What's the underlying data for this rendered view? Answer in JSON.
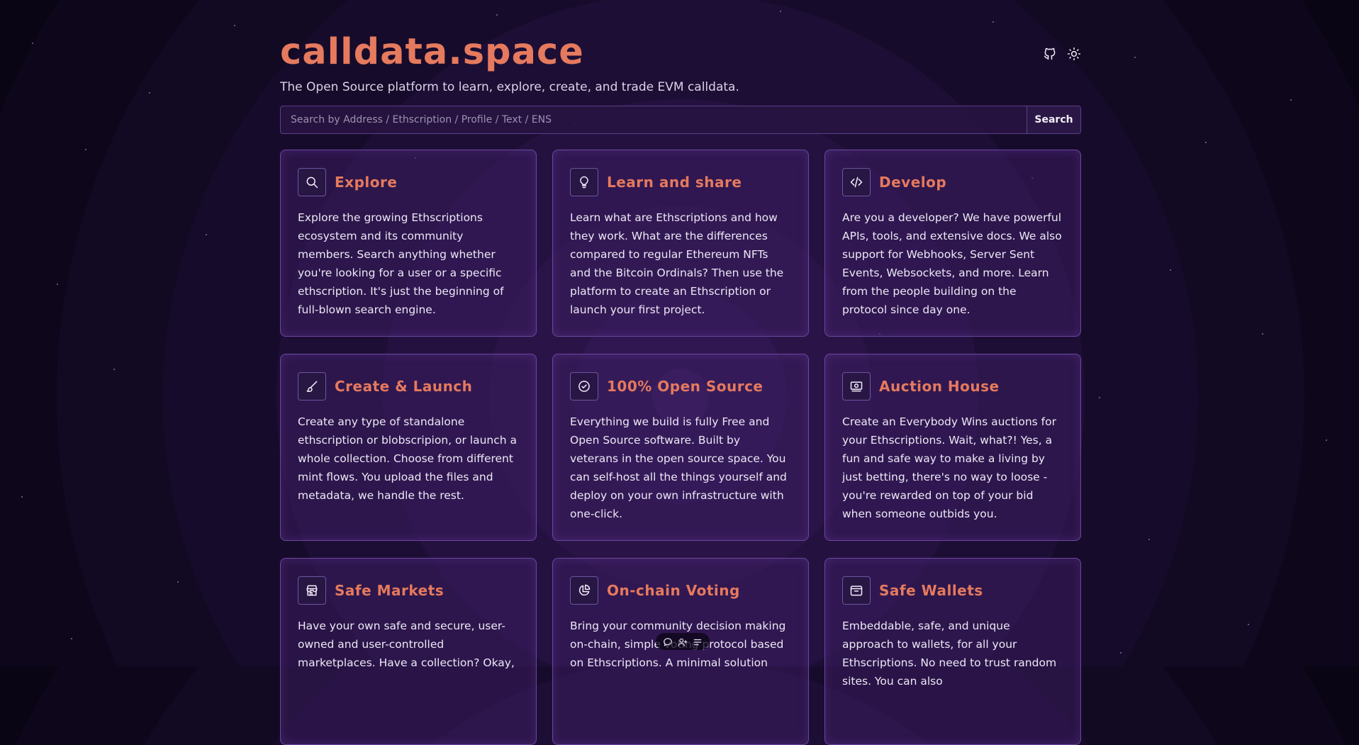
{
  "header": {
    "logo": "calldata.space",
    "tagline": "The Open Source platform to learn, explore, create, and trade EVM calldata.",
    "icons": [
      "github-icon",
      "sun-icon"
    ]
  },
  "search": {
    "placeholder": "Search by Address / Ethscription / Profile / Text / ENS",
    "value": "",
    "button_label": "Search"
  },
  "cards": [
    {
      "icon": "search-icon",
      "title": "Explore",
      "text": "Explore the growing Ethscriptions ecosystem and its community members. Search anything whether you're looking for a user or a specific ethscription. It's just the beginning of full-blown search engine."
    },
    {
      "icon": "lightbulb-icon",
      "title": "Learn and share",
      "text": "Learn what are Ethscriptions and how they work. What are the differences compared to regular Ethereum NFTs and the Bitcoin Ordinals? Then use the platform to create an Ethscription or launch your first project."
    },
    {
      "icon": "code-icon",
      "title": "Develop",
      "text": "Are you a developer? We have powerful APIs, tools, and extensive docs. We also support for Webhooks, Server Sent Events, Websockets, and more. Learn from the people building on the protocol since day one."
    },
    {
      "icon": "brush-icon",
      "title": "Create & Launch",
      "text": "Create any type of standalone ethscription or blobscripion, or launch a whole collection. Choose from different mint flows. You upload the files and metadata, we handle the rest."
    },
    {
      "icon": "badge-check-icon",
      "title": "100% Open Source",
      "text": "Everything we build is fully Free and Open Source software. Built by veterans in the open source space. You can self-host all the things yourself and deploy on your own infrastructure with one-click."
    },
    {
      "icon": "cash-icon",
      "title": "Auction House",
      "text": "Create an Everybody Wins auctions for your Ethscriptions. Wait, what?! Yes, a fun and safe way to make a living by just betting, there's no way to loose - you're rewarded on top of your bid when someone outbids you."
    },
    {
      "icon": "store-icon",
      "title": "Safe Markets",
      "text": "Have your own safe and secure, user-owned and user-controlled marketplaces. Have a collection? Okay,"
    },
    {
      "icon": "pie-chart-icon",
      "title": "On-chain Voting",
      "text": "Bring your community decision making on-chain, simple voting protocol based on Ethscriptions. A minimal solution"
    },
    {
      "icon": "wallet-icon",
      "title": "Safe Wallets",
      "text": "Embeddable, safe, and unique approach to wallets, for all your Ethscriptions. No need to trust random sites. You can also"
    }
  ],
  "floating_toolbar": {
    "icons": [
      "comment-icon",
      "user-add-icon",
      "menu-icon"
    ]
  },
  "colors": {
    "accent": "#e57a5e",
    "card_border": "#6b47a0",
    "background": "#0a0514"
  }
}
